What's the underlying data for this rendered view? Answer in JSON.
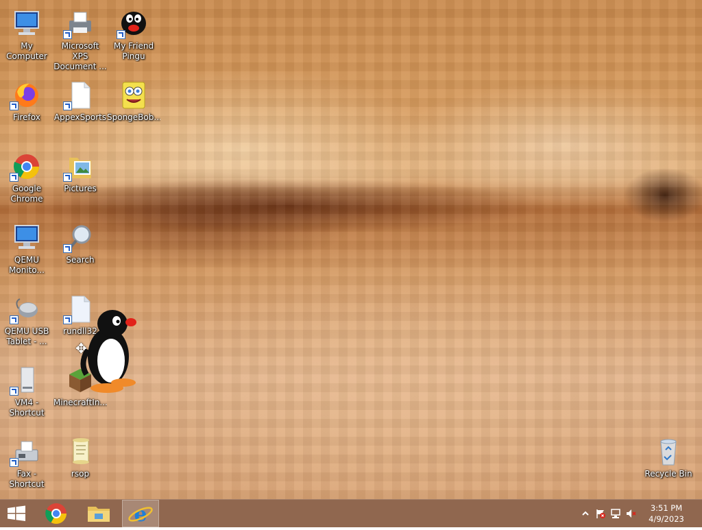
{
  "desktop": {
    "icons": [
      {
        "label": "My Computer",
        "shortcut": false
      },
      {
        "label": "Microsoft XPS\nDocument ...",
        "shortcut": true
      },
      {
        "label": "My Friend\nPingu",
        "shortcut": true
      },
      {
        "label": "Firefox",
        "shortcut": true
      },
      {
        "label": "AppexSports",
        "shortcut": true
      },
      {
        "label": "SpongeBob...",
        "shortcut": false
      },
      {
        "label": "Google\nChrome",
        "shortcut": true
      },
      {
        "label": "Pictures",
        "shortcut": true
      },
      {
        "label": "QEMU\nMonito...",
        "shortcut": false
      },
      {
        "label": "Search",
        "shortcut": true
      },
      {
        "label": "QEMU USB\nTablet - ...",
        "shortcut": true
      },
      {
        "label": "rundll32",
        "shortcut": true
      },
      {
        "label": "VM4 -\nShortcut",
        "shortcut": true
      },
      {
        "label": "MinecraftIn...",
        "shortcut": false
      },
      {
        "label": "Fax - Shortcut",
        "shortcut": true
      },
      {
        "label": "rsop",
        "shortcut": false
      },
      {
        "label": "Recycle Bin",
        "shortcut": false
      }
    ]
  },
  "taskbar": {
    "start_icon": "windows-logo-icon",
    "pinned": [
      "chrome-icon",
      "file-explorer-icon",
      "internet-explorer-icon"
    ],
    "active_app": "internet-explorer-icon",
    "tray_icons": [
      "show-hidden-icons-chevron",
      "action-center-flag-icon",
      "network-icon",
      "volume-muted-icon"
    ],
    "clock": {
      "time": "3:51 PM",
      "date": "4/9/2023"
    }
  },
  "colors": {
    "taskbar": "#784628",
    "label_text": "#ffffff",
    "ie_blue": "#1e7fd8"
  }
}
